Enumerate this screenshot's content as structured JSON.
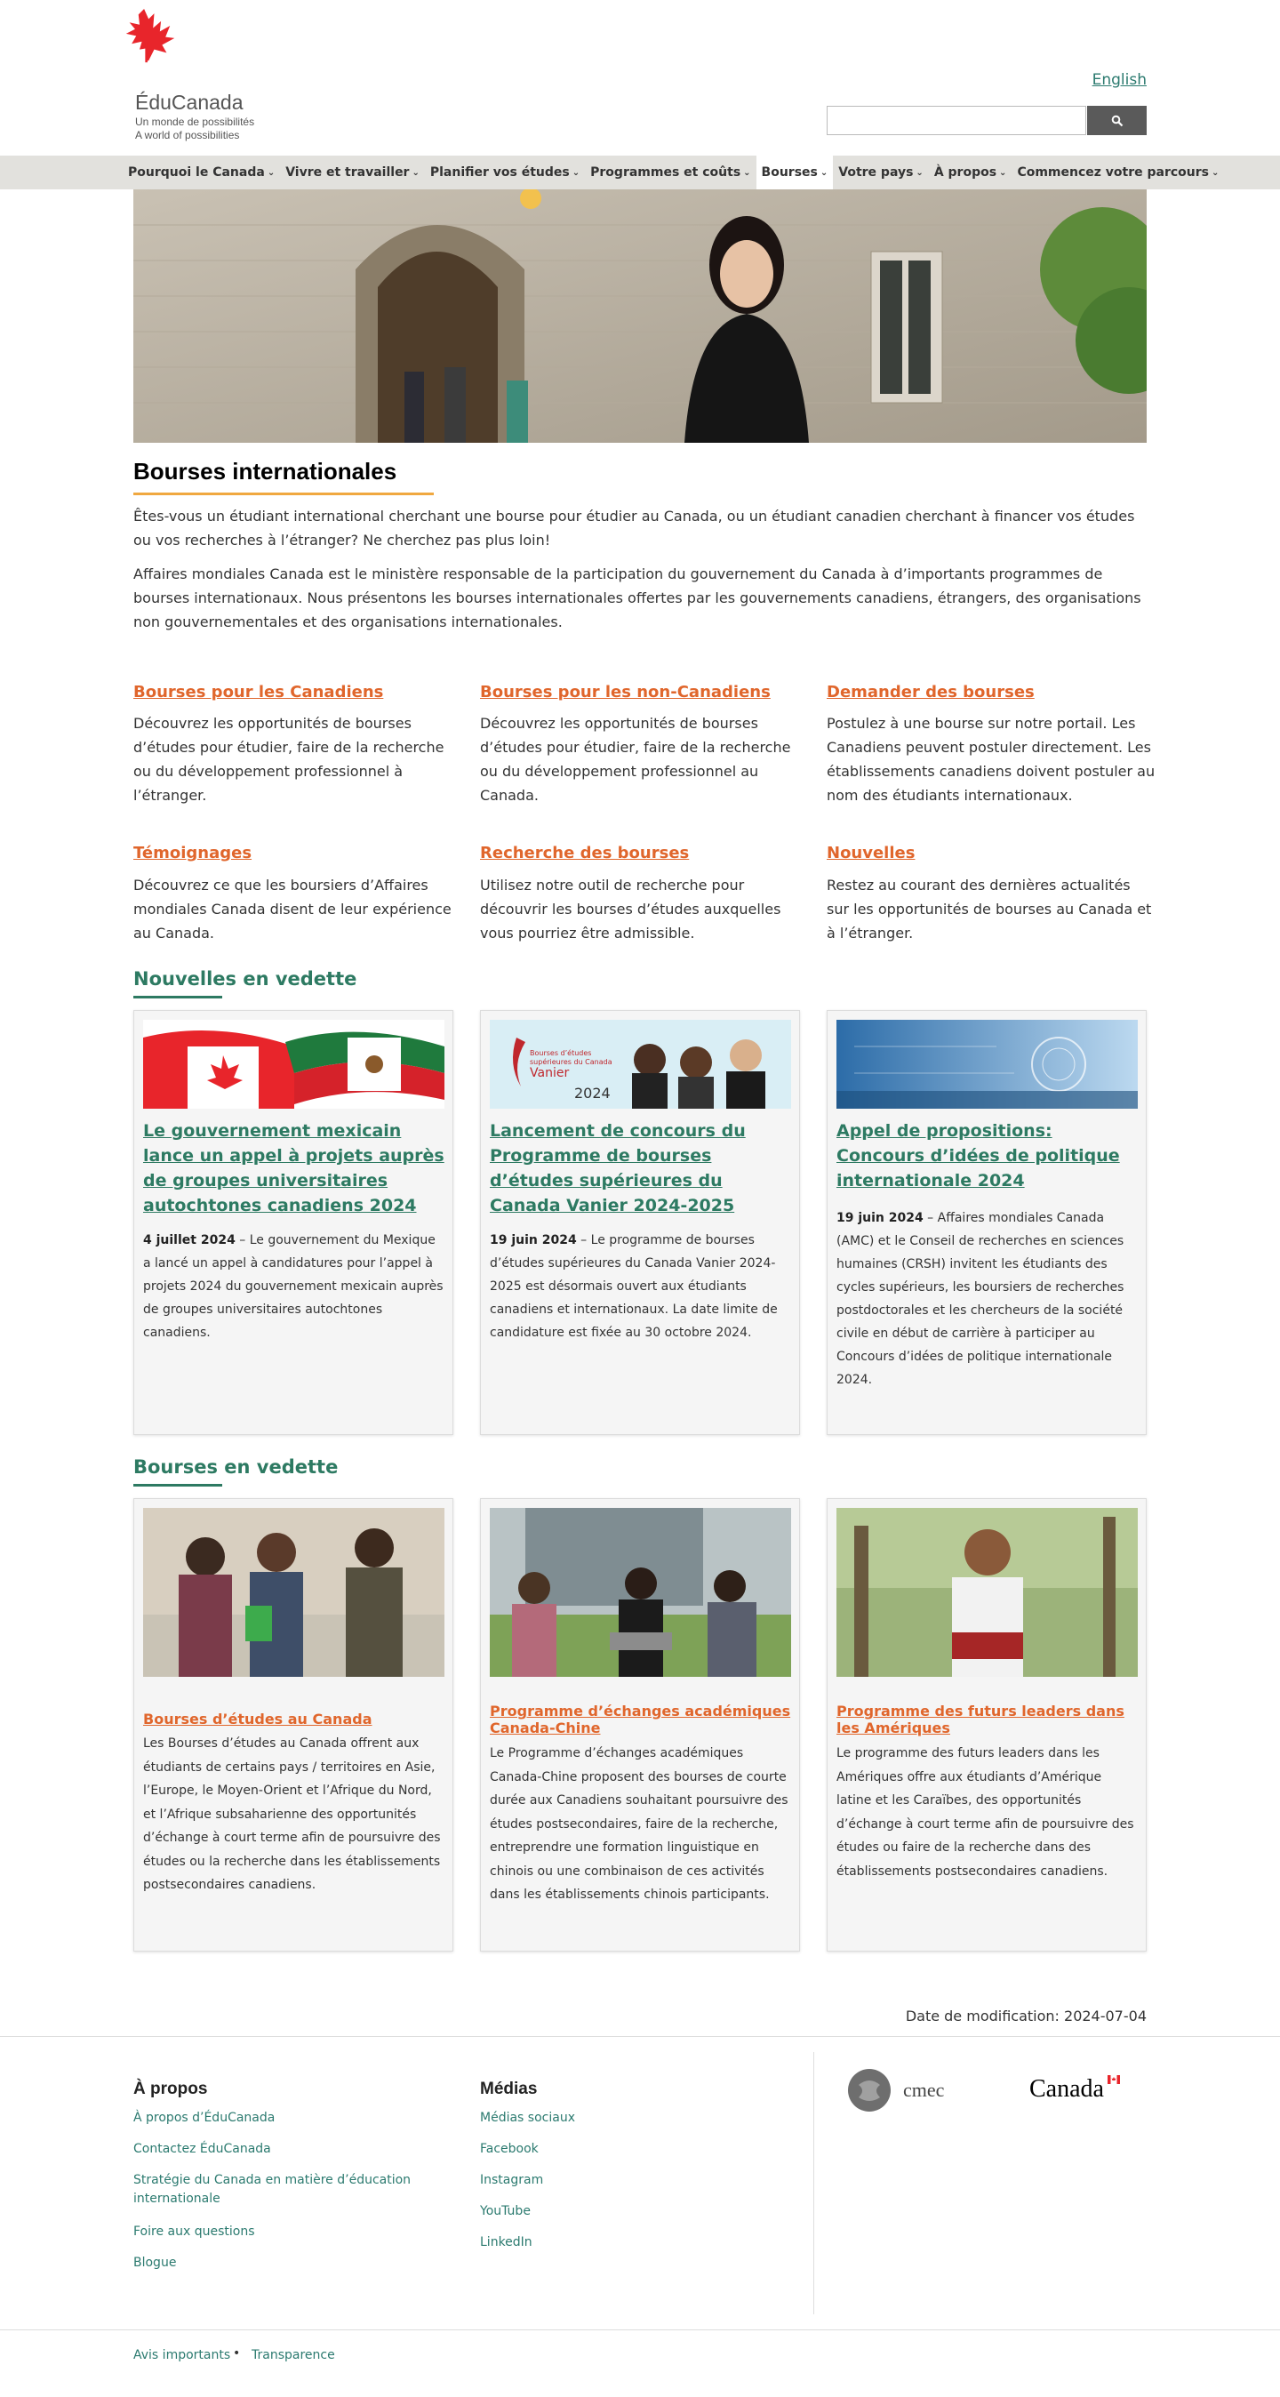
{
  "header": {
    "logo_name": "ÉduCanada",
    "logo_tagline_fr": "Un monde de possibilités",
    "logo_tagline_en": "A world of possibilities",
    "language_link": "English",
    "search_placeholder": ""
  },
  "nav": {
    "items": [
      {
        "label": "Pourquoi le Canada"
      },
      {
        "label": "Vivre et travailler"
      },
      {
        "label": "Planifier vos études"
      },
      {
        "label": "Programmes et coûts"
      },
      {
        "label": "Bourses"
      },
      {
        "label": "Votre pays"
      },
      {
        "label": "À propos"
      },
      {
        "label": "Commencez votre parcours"
      }
    ]
  },
  "intro": {
    "title": "Bourses internationales",
    "p1": "Êtes-vous un étudiant international cherchant une bourse pour étudier au Canada, ou un étudiant canadien cherchant à financer vos études ou vos recherches à l’étranger? Ne cherchez pas plus loin!",
    "p2": "Affaires mondiales Canada est le ministère responsable de la participation du gouvernement du Canada à d’importants programmes de bourses internationaux. Nous présentons les bourses internationales offertes par les gouvernements canadiens, étrangers, des organisations non gouvernementales et des organisations internationales."
  },
  "link_blocks": [
    {
      "title": "Bourses pour les Canadiens",
      "desc": "Découvrez les opportunités de bourses d’études pour étudier, faire de la recherche ou du développement professionnel à l’étranger."
    },
    {
      "title": "Bourses pour les non-Canadiens",
      "desc": "Découvrez les opportunités de bourses d’études pour étudier, faire de la recherche ou du développement professionnel au Canada."
    },
    {
      "title": "Demander des bourses",
      "desc": "Postulez à une bourse sur notre portail. Les Canadiens peuvent postuler directement. Les établissements canadiens doivent postuler au nom des étudiants internationaux."
    },
    {
      "title": "Témoignages",
      "desc": "Découvrez ce que les boursiers d’Affaires mondiales Canada disent de leur expérience au Canada."
    },
    {
      "title": "Recherche des bourses",
      "desc": "Utilisez notre outil de recherche pour découvrir les bourses d’études auxquelles vous pourriez être admissible."
    },
    {
      "title": "Nouvelles",
      "desc": "Restez au courant des dernières actualités sur les opportunités de bourses au Canada et à l’étranger."
    }
  ],
  "news": {
    "heading": "Nouvelles en vedette",
    "items": [
      {
        "title": "Le gouvernement mexicain lance un appel à projets auprès de groupes universitaires autochtones canadiens 2024",
        "date": "4 juillet 2024",
        "text": " – Le gouvernement du Mexique a lancé un appel à candidatures pour l’appel à projets 2024 du gouvernement mexicain auprès de groupes universitaires autochtones canadiens."
      },
      {
        "title": "Lancement de concours du Programme de bourses d’études supérieures du Canada Vanier 2024-2025",
        "date": "19 juin 2024",
        "text": " – Le programme de bourses d’études supérieures du Canada Vanier 2024-2025 est désormais ouvert aux étudiants canadiens et internationaux. La date limite de candidature est fixée au 30 octobre 2024.",
        "img_line1": "Bourses d’études",
        "img_line2": "supérieures du Canada",
        "img_line3": "Vanier",
        "img_year": "2024"
      },
      {
        "title": "Appel de propositions: Concours d’idées de politique internationale 2024",
        "date": "19 juin 2024",
        "text": " – Affaires mondiales Canada (AMC) et le Conseil de recherches en sciences humaines (CRSH) invitent les étudiants des cycles supérieurs, les boursiers de recherches postdoctorales et les chercheurs de la société civile en début de carrière à participer au Concours d’idées de politique internationale 2024."
      }
    ]
  },
  "scholarships": {
    "heading": "Bourses en vedette",
    "items": [
      {
        "title": "Bourses d’études au Canada",
        "text": "Les Bourses d’études au Canada offrent aux étudiants de certains pays / territoires en Asie, l’Europe, le Moyen-Orient et l’Afrique du Nord, et l’Afrique subsaharienne des opportunités d’échange à court terme afin de poursuivre des études ou la recherche dans les établissements postsecondaires canadiens."
      },
      {
        "title": "Programme d’échanges académiques Canada-Chine",
        "text": "Le Programme d’échanges académiques Canada-Chine proposent des bourses de courte durée aux Canadiens souhaitant poursuivre des études postsecondaires, faire de la recherche, entreprendre une formation linguistique en chinois ou une combinaison de ces activités dans les établissements chinois participants."
      },
      {
        "title": "Programme des futurs leaders dans les Amériques",
        "text": "Le programme des futurs leaders dans les Amériques offre aux étudiants d’Amérique latine et les Caraïbes, des opportunités d’échange à court terme afin de poursuivre des études ou faire de la recherche dans des établissements postsecondaires canadiens."
      }
    ]
  },
  "modified": "Date de modification: 2024-07-04",
  "footer": {
    "about_heading": "À propos",
    "about_links": [
      "À propos d’ÉduCanada",
      "Contactez ÉduCanada",
      "Stratégie du Canada en matière d’éducation internationale",
      "Foire aux questions",
      "Blogue"
    ],
    "media_heading": "Médias",
    "media_links": [
      "Médias sociaux",
      "Facebook",
      "Instagram",
      "YouTube",
      "LinkedIn"
    ],
    "cmec_label": "cmec",
    "canada_wordmark": "Canada",
    "legal_links": [
      "Avis importants",
      "Transparence"
    ],
    "legal_separator": "•"
  },
  "colors": {
    "accent_orange": "#e0662c",
    "accent_green": "#2d7a62",
    "nav_bg": "#e2e1dd",
    "title_rule": "#f0a840",
    "maple_red": "#e8252b"
  }
}
